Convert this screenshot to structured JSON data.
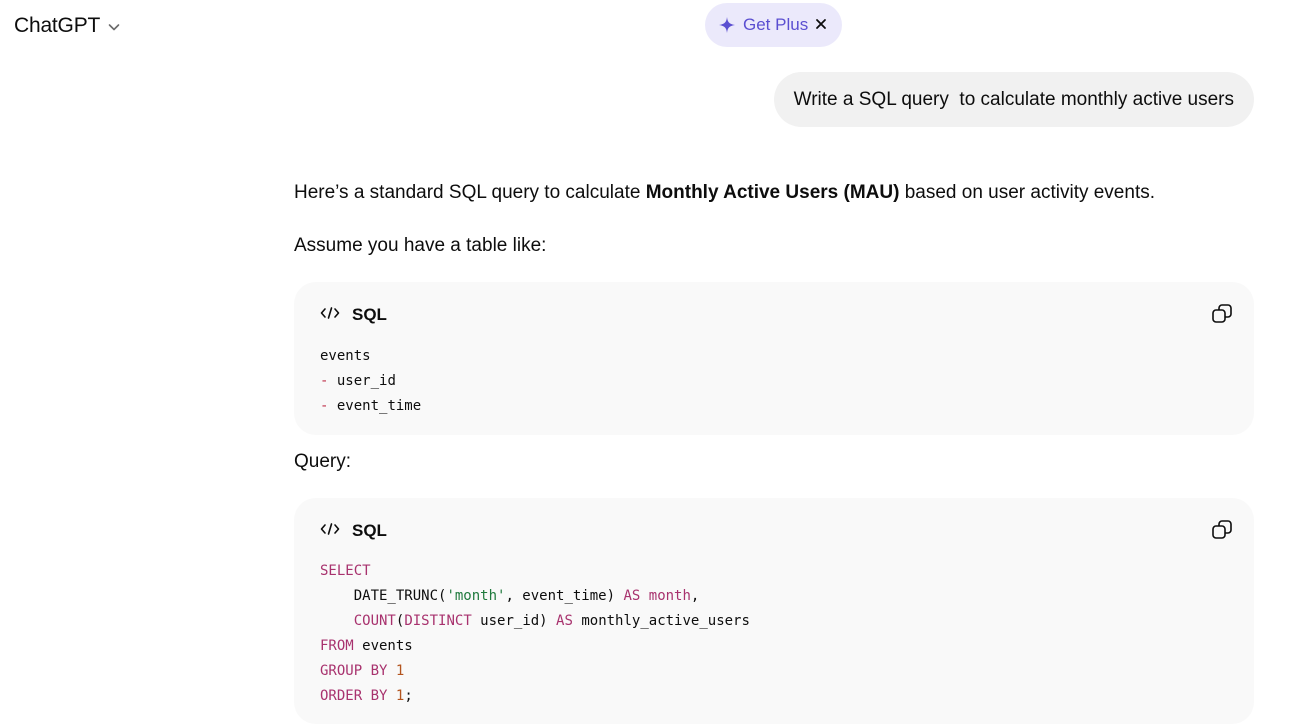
{
  "header": {
    "title": "ChatGPT"
  },
  "promo": {
    "label": "Get Plus",
    "close_glyph": "×"
  },
  "user_message": {
    "text": "Write a SQL query  to calculate monthly active users"
  },
  "assistant": {
    "intro_pre": "Here’s a standard SQL query to calculate ",
    "intro_bold": "Monthly Active Users (MAU)",
    "intro_post": " based on user activity events.",
    "assume": "Assume you have a table like:",
    "query_label": "Query:"
  },
  "code_blocks": [
    {
      "language": "SQL",
      "lines": [
        "events",
        "- user_id",
        "- event_time"
      ]
    },
    {
      "language": "SQL",
      "lines": [
        "SELECT",
        "    DATE_TRUNC('month', event_time) AS month,",
        "    COUNT(DISTINCT user_id) AS monthly_active_users",
        "FROM events",
        "GROUP BY 1",
        "ORDER BY 1;"
      ]
    }
  ],
  "icons": {
    "chevron": "chevron-down-icon",
    "sparkle": "sparkle-icon",
    "close": "close-icon",
    "code": "code-icon",
    "copy": "copy-icon"
  },
  "colors": {
    "accent": "#5b4fd1",
    "promo_bg": "#ebe9fb",
    "keyword": "#a8326e",
    "string": "#1f7a3d",
    "number": "#b3541e"
  }
}
